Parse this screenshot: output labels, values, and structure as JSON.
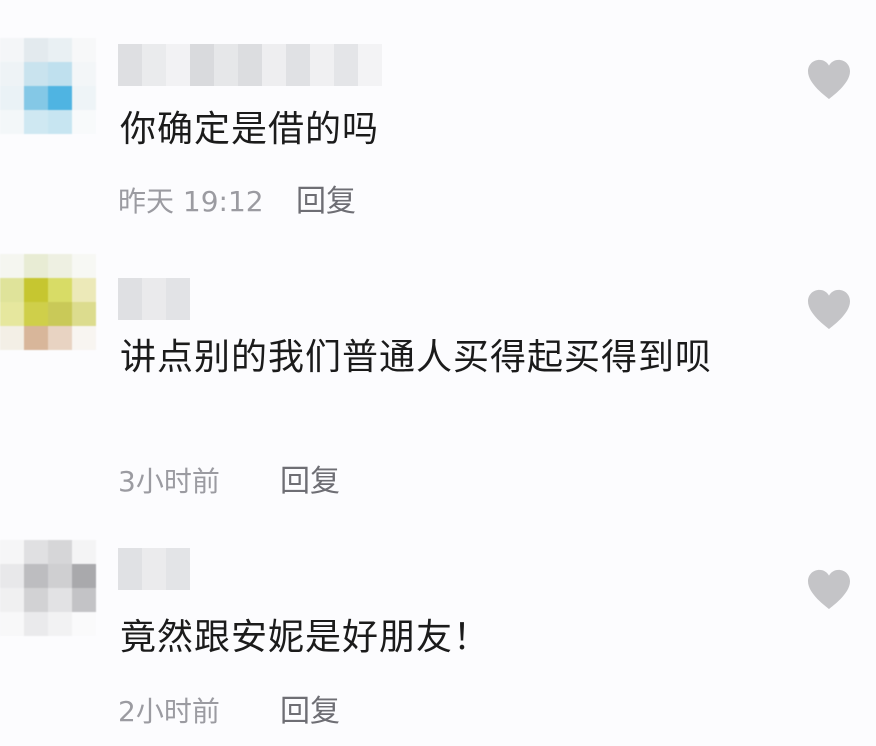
{
  "comments": [
    {
      "text": "你确定是借的吗",
      "time": "昨天 19:12",
      "reply_label": "回复"
    },
    {
      "text": "讲点别的我们普通人买得起买得到呗",
      "time": "3小时前",
      "reply_label": "回复"
    },
    {
      "text": "竟然跟安妮是好朋友！",
      "time": "2小时前",
      "reply_label": "回复"
    }
  ],
  "icons": {
    "like": "heart-icon"
  },
  "colors": {
    "like_heart": "#c4c4c7",
    "meta_text": "#9b9ba1",
    "comment_text": "#1b1b1b",
    "background": "#fcfcfe"
  }
}
